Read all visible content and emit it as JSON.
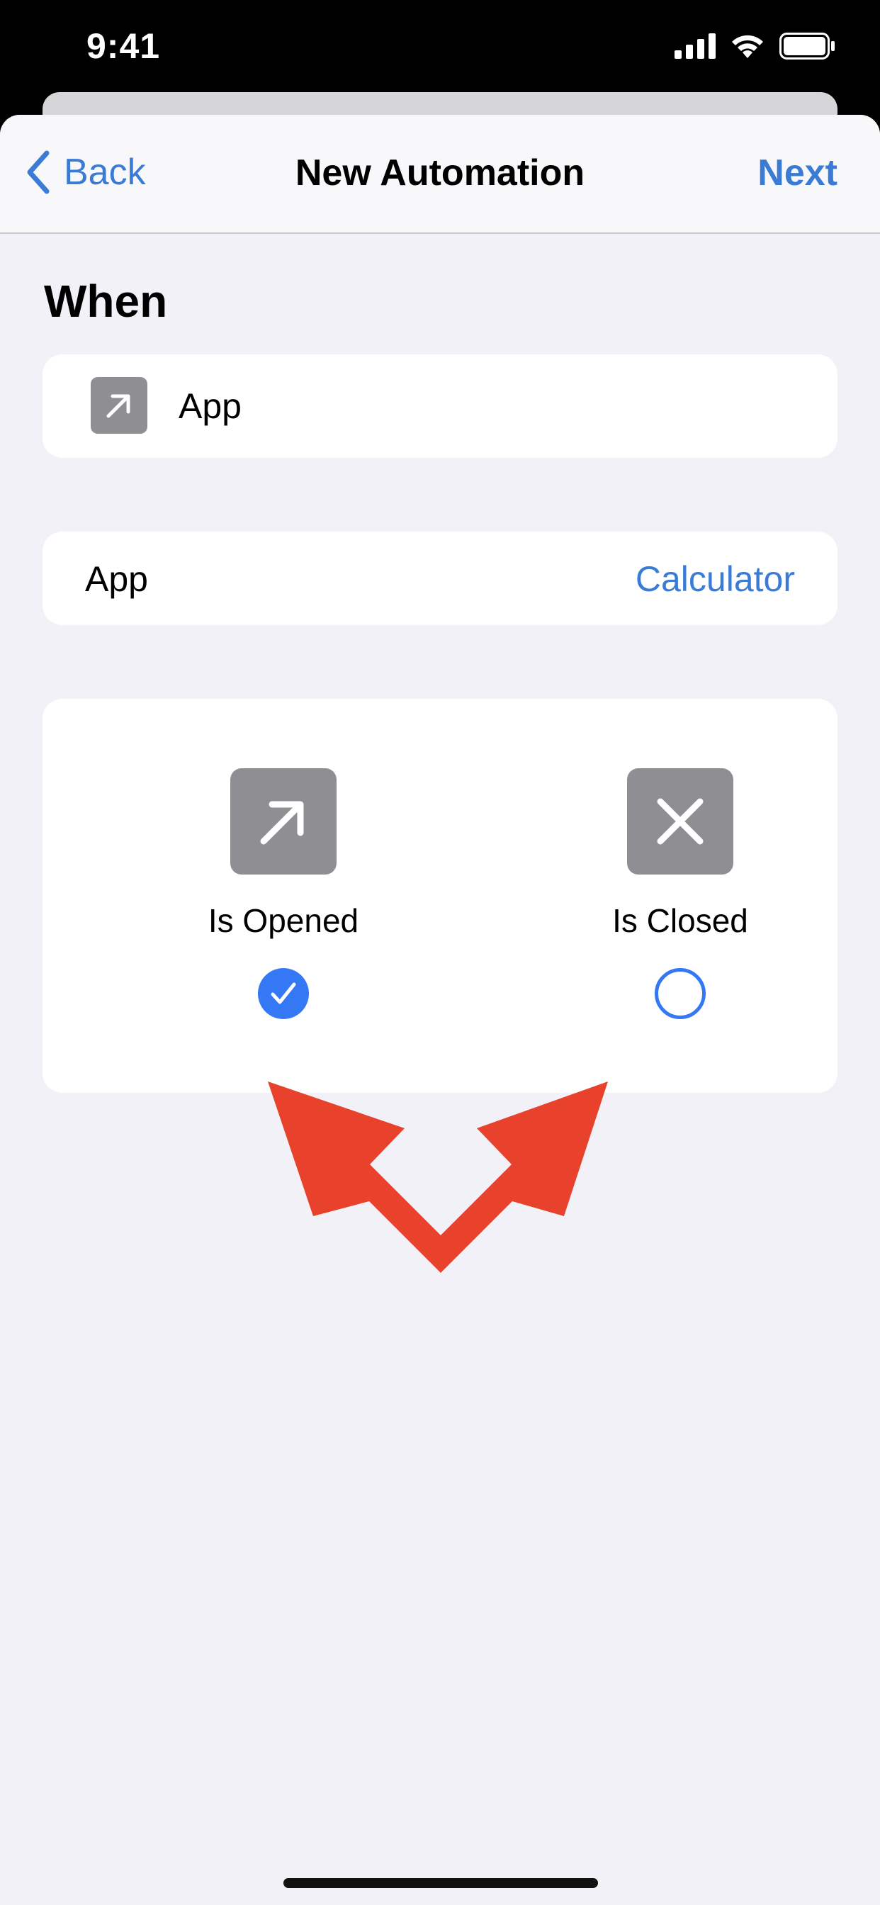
{
  "status_bar": {
    "time": "9:41",
    "icons": [
      "cellular-signal-icon",
      "wifi-icon",
      "battery-icon"
    ]
  },
  "nav": {
    "back_label": "Back",
    "title": "New Automation",
    "next_label": "Next"
  },
  "section": {
    "title": "When"
  },
  "trigger": {
    "icon": "arrow-up-right-icon",
    "label": "App"
  },
  "app_row": {
    "label": "App",
    "value": "Calculator"
  },
  "options": [
    {
      "icon": "arrow-up-right-icon",
      "label": "Is Opened",
      "selected": true
    },
    {
      "icon": "close-x-icon",
      "label": "Is Closed",
      "selected": false
    }
  ],
  "colors": {
    "accent": "#3478f6",
    "link": "#3a7bd5",
    "icon_gray": "#8e8e93",
    "annotation_arrow": "#e8412c",
    "background": "#f1f1f7"
  }
}
